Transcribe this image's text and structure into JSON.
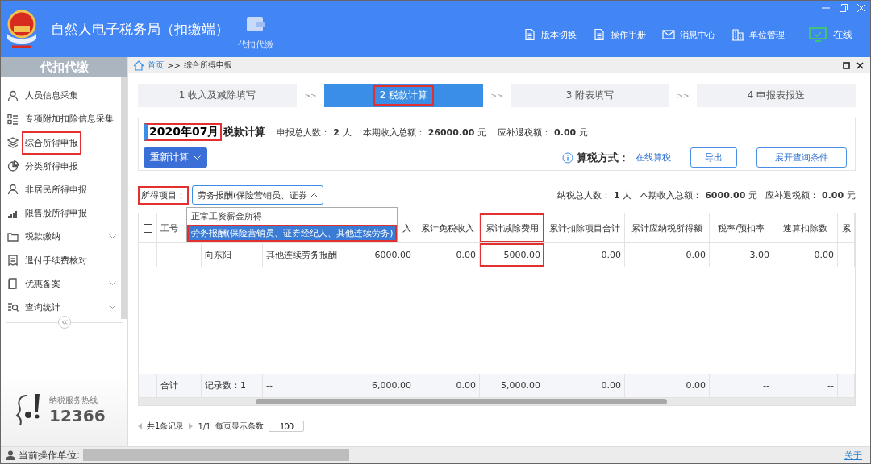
{
  "app": {
    "title": "自然人电子税务局（扣缴端）",
    "module": "代扣代缴",
    "top_links": [
      {
        "label": "版本切换",
        "kind": "doc"
      },
      {
        "label": "操作手册",
        "kind": "doc"
      },
      {
        "label": "消息中心",
        "kind": "mail"
      },
      {
        "label": "单位管理",
        "kind": "building"
      }
    ],
    "status": "在线"
  },
  "sidebar": {
    "title": "代扣代缴",
    "items": [
      {
        "label": "人员信息采集",
        "kind": "person",
        "expandable": false,
        "highlighted": false
      },
      {
        "label": "专项附加扣除信息采集",
        "kind": "list",
        "expandable": false,
        "highlighted": false
      },
      {
        "label": "综合所得申报",
        "kind": "layers",
        "expandable": false,
        "highlighted": true
      },
      {
        "label": "分类所得申报",
        "kind": "pie",
        "expandable": false,
        "highlighted": false
      },
      {
        "label": "非居民所得申报",
        "kind": "person",
        "expandable": false,
        "highlighted": false
      },
      {
        "label": "限售股所得申报",
        "kind": "bars",
        "expandable": false,
        "highlighted": false
      },
      {
        "label": "税款缴纳",
        "kind": "folder",
        "expandable": true,
        "highlighted": false
      },
      {
        "label": "退付手续费核对",
        "kind": "receipt",
        "expandable": false,
        "highlighted": false
      },
      {
        "label": "优惠备案",
        "kind": "page",
        "expandable": true,
        "highlighted": false
      },
      {
        "label": "查询统计",
        "kind": "search",
        "expandable": true,
        "highlighted": false
      }
    ],
    "hotline_label": "纳税服务热线",
    "hotline": "12366"
  },
  "breadcrumb": {
    "home": "首页",
    "separator": ">>",
    "current": "综合所得申报"
  },
  "steps": [
    {
      "label": "1 收入及减除填写",
      "selected": false
    },
    {
      "label": "2 税款计算",
      "selected": true
    },
    {
      "label": "3 附表填写",
      "selected": false
    },
    {
      "label": "4 申报表报送",
      "selected": false
    }
  ],
  "step_separator": ">>",
  "summary": {
    "period": "2020年07月",
    "title": "税款计算",
    "stats": [
      {
        "label": "申报总人数：",
        "value": "2",
        "unit": "人"
      },
      {
        "label": "本期收入总额：",
        "value": "26000.00",
        "unit": "元"
      },
      {
        "label": "应补退税额：",
        "value": "0.00",
        "unit": "元"
      }
    ],
    "recalc_button": "重新计算",
    "method_label": "算税方式：",
    "method_value": "在线算税",
    "export_button": "导出",
    "expand_button": "展开查询条件"
  },
  "filter": {
    "label": "所得项目：",
    "value": "劳务报酬(保险营销员、证券",
    "options": [
      {
        "label": "正常工资薪金所得",
        "selected": false
      },
      {
        "label": "劳务报酬(保险营销员、证券经纪人、其他连续劳务)",
        "selected": true
      }
    ],
    "stats": [
      {
        "label": "纳税总人数：",
        "value": "1",
        "unit": "人"
      },
      {
        "label": "本期收入总额：",
        "value": "6000.00",
        "unit": "元"
      },
      {
        "label": "应补退税额：",
        "value": "0.00",
        "unit": "元"
      }
    ]
  },
  "table": {
    "select_all_checked": false,
    "columns": [
      {
        "label": "工号",
        "highlighted": false
      },
      {},
      {},
      {
        "label": "入",
        "highlighted": false
      },
      {
        "label": "累计免税收入",
        "highlighted": false
      },
      {
        "label": "累计减除费用",
        "highlighted": true
      },
      {
        "label": "累计扣除项目合计",
        "highlighted": false
      },
      {
        "label": "累计应纳税所得额",
        "highlighted": false
      },
      {
        "label": "税率/预扣率",
        "highlighted": false
      },
      {
        "label": "速算扣除数",
        "highlighted": false
      },
      {
        "label": "累",
        "highlighted": false
      }
    ],
    "rows": [
      {
        "checked": false,
        "cells": [
          "",
          "向东阳",
          "其他连续劳务报酬",
          "6000.00",
          "0.00",
          "5000.00",
          "0.00",
          "0.00",
          "3.00",
          "0.00"
        ]
      }
    ],
    "totals": [
      "合计",
      "记录数：1",
      "--",
      "6,000.00",
      "0.00",
      "5,000.00",
      "0.00",
      "0.00",
      "--",
      "--"
    ]
  },
  "pagination": {
    "records": "共1条记录",
    "pages": "1/1",
    "page_size_label": "每页显示条数",
    "page_size": "100"
  },
  "status_bar": {
    "label": "当前操作单位:",
    "about": "关于"
  }
}
